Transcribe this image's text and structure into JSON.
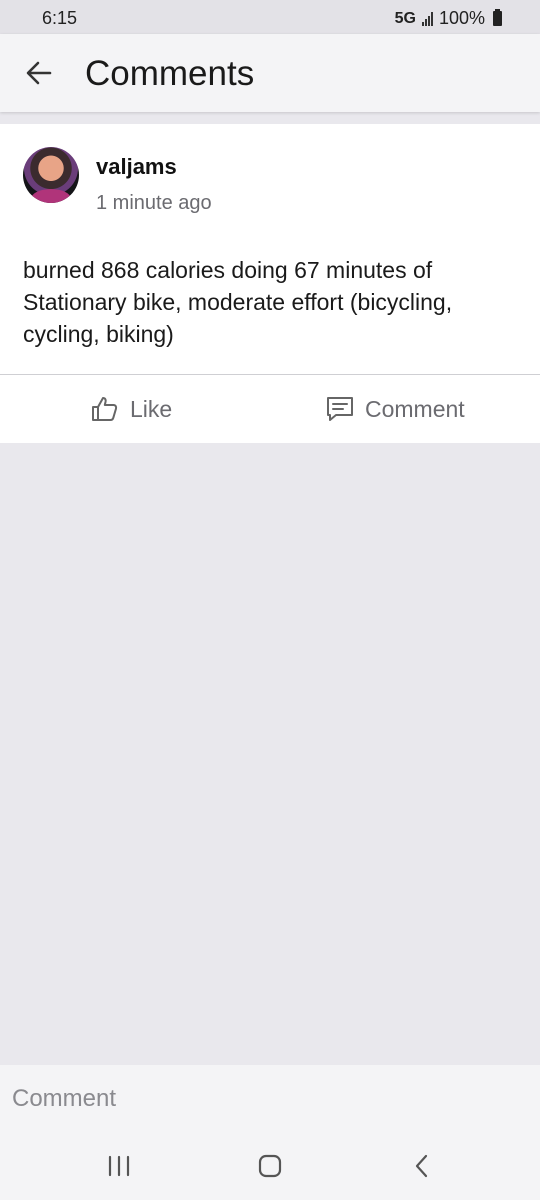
{
  "status_bar": {
    "time": "6:15",
    "network": "5G",
    "battery": "100%"
  },
  "header": {
    "title": "Comments",
    "back_icon": "arrow-left-icon"
  },
  "post": {
    "username": "valjams",
    "timestamp": "1 minute ago",
    "text": "burned 868 calories doing 67 minutes of Stationary bike, moderate effort (bicycling, cycling, biking)",
    "avatar_icon": "user-avatar"
  },
  "actions": {
    "like_label": "Like",
    "like_icon": "thumbs-up-icon",
    "comment_label": "Comment",
    "comment_icon": "comment-bubble-icon"
  },
  "comment_input": {
    "placeholder": "Comment",
    "value": ""
  },
  "nav_bar": {
    "recents_icon": "recents-icon",
    "home_icon": "home-icon",
    "back_icon": "back-chevron-icon"
  },
  "colors": {
    "background": "#e9e8ed",
    "card": "#ffffff",
    "secondary_text": "#6b6b70"
  }
}
